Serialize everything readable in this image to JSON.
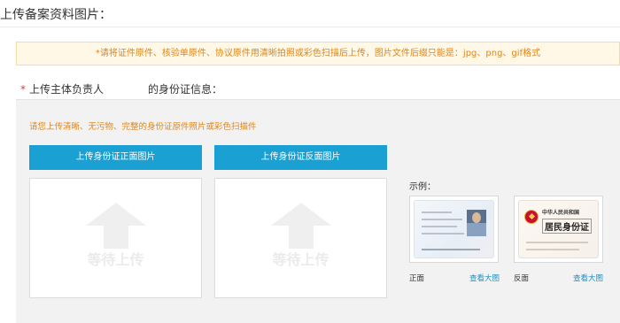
{
  "section": {
    "title": "上传备案资料图片："
  },
  "notice": {
    "text": "*请将证件原件、核验单原件、协议原件用清晰拍照或彩色扫描后上传，图片文件后缀只能是：jpg、png、gif格式"
  },
  "uploadRow": {
    "required_mark": "*",
    "label": "上传主体负责人",
    "suffix": "的身份证信息："
  },
  "panel": {
    "hint": "请您上传清晰、无污物、完整的身份证原件照片或彩色扫描件",
    "buttons": {
      "front": "上传身份证正面图片",
      "back": "上传身份证反面图片"
    },
    "placeholder": "等待上传"
  },
  "example": {
    "label": "示例：",
    "front_caption": "正面",
    "back_caption": "反面",
    "view_large": "查看大图",
    "back_card": {
      "line1": "中华人民共和国",
      "line2": "居民身份证"
    }
  },
  "colors": {
    "accent": "#1aa0d2",
    "warning": "#e0861a",
    "link": "#1a8fc9"
  }
}
